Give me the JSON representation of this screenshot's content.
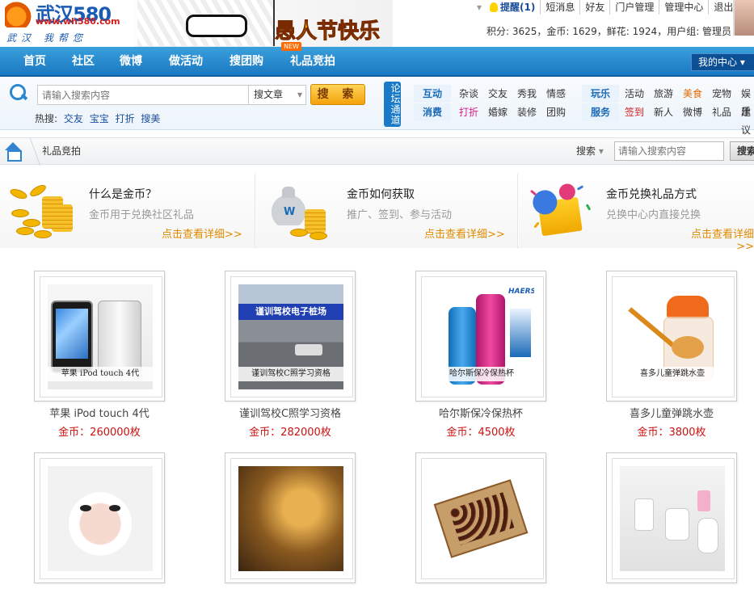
{
  "header": {
    "logo": {
      "name": "武汉580",
      "url": "www.wh580.com",
      "slogan": "武汉  我帮您"
    },
    "banner": {
      "text": "愚人节快乐"
    },
    "user_links": {
      "dropdown": "▾",
      "remind": "提醒(1)",
      "messages": "短消息",
      "friends": "好友",
      "portal_manage": "门户管理",
      "admin_center": "管理中心",
      "logout": "退出"
    },
    "stats": "积分: 3625，金币: 1629，鲜花: 1924，用户组: 管理员"
  },
  "nav": {
    "items": [
      "首页",
      "社区",
      "微博",
      "做活动",
      "搜团购",
      "礼品竞拍"
    ],
    "new_badge": "NEW",
    "my_center": "我的中心 ▾"
  },
  "search": {
    "placeholder": "请输入搜索内容",
    "scope": "搜文章",
    "button": "搜 索",
    "hot_label": "热搜:",
    "hot_items": [
      "交友",
      "宝宝",
      "打折",
      "搜美"
    ],
    "portal_label": "论坛通道"
  },
  "categories": {
    "row1_label": "互动",
    "row1_items": [
      "杂谈",
      "交友",
      "秀我",
      "情感"
    ],
    "row1_label2": "玩乐",
    "row1_items2": [
      "活动",
      "旅游",
      "美食",
      "宠物",
      "娱乐"
    ],
    "row2_label": "消费",
    "row2_items": [
      "打折",
      "婚嫁",
      "装修",
      "团购"
    ],
    "row2_label2": "服务",
    "row2_items2": [
      "签到",
      "新人",
      "微博",
      "礼品",
      "建议"
    ]
  },
  "breadcrumb": {
    "current": "礼品竞拍",
    "search_label": "搜索",
    "search_placeholder": "请输入搜索内容",
    "search_button": "搜索"
  },
  "info_cards": [
    {
      "title": "什么是金币？",
      "desc": "金币用于兑换社区礼品",
      "more": "点击查看详细>>"
    },
    {
      "title": "金币如何获取",
      "desc": "推广、签到、参与活动",
      "more": "点击查看详细>>"
    },
    {
      "title": "金币兑换礼品方式",
      "desc": "兑换中心内直接兑换",
      "more": "点击查看详细>>"
    }
  ],
  "products": [
    {
      "name": "苹果 iPod touch 4代",
      "price": "金币：260000枚",
      "caption": "苹果 iPod touch 4代"
    },
    {
      "name": "谨训驾校C照学习资格",
      "price": "金币：282000枚",
      "caption": "谨训驾校C照学习资格",
      "sign": "谨训驾校电子桩场"
    },
    {
      "name": "哈尔斯保冷保热杯",
      "price": "金币：4500枚",
      "caption": "哈尔斯保冷保热杯",
      "brand": "HAERS"
    },
    {
      "name": "喜多儿童弹跳水壶",
      "price": "金币：3800枚",
      "caption": "喜多儿童弹跳水壶"
    }
  ],
  "colors": {
    "nav": "#1a78c2",
    "price": "#cc1111",
    "more": "#e08a00",
    "search_button": "#f3a20a"
  }
}
